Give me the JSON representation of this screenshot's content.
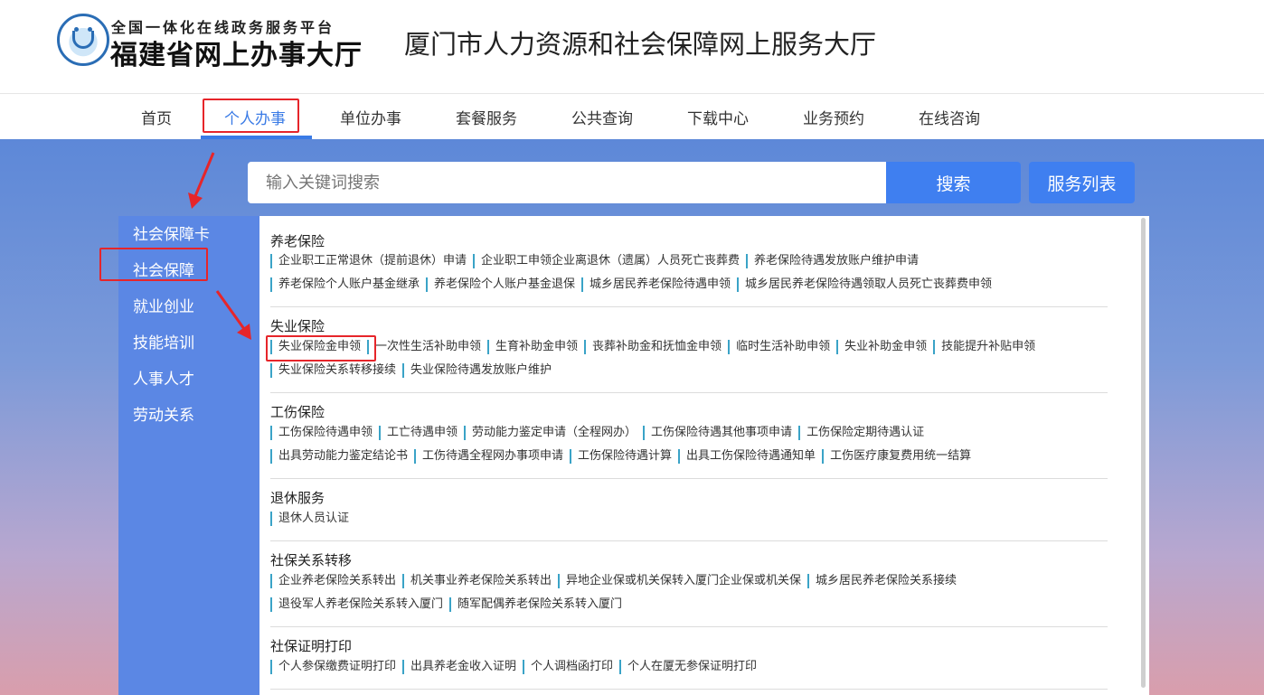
{
  "header": {
    "logo_sub": "全国一体化在线政务服务平台",
    "logo_main": "福建省网上办事大厅",
    "site_title": "厦门市人力资源和社会保障网上服务大厅"
  },
  "nav": {
    "items": [
      "首页",
      "个人办事",
      "单位办事",
      "套餐服务",
      "公共查询",
      "下载中心",
      "业务预约",
      "在线咨询"
    ],
    "active": "个人办事"
  },
  "search": {
    "placeholder": "输入关键词搜索",
    "search_label": "搜索",
    "list_label": "服务列表"
  },
  "sidebar": {
    "items": [
      "社会保障卡",
      "社会保障",
      "就业创业",
      "技能培训",
      "人事人才",
      "劳动关系"
    ],
    "selected": "社会保障"
  },
  "sections": [
    {
      "title": "养老保险",
      "rows": [
        [
          "企业职工正常退休（提前退休）申请",
          "企业职工申领企业离退休（遗属）人员死亡丧葬费",
          "养老保险待遇发放账户维护申请"
        ],
        [
          "养老保险个人账户基金继承",
          "养老保险个人账户基金退保",
          "城乡居民养老保险待遇申领",
          "城乡居民养老保险待遇领取人员死亡丧葬费申领"
        ]
      ]
    },
    {
      "title": "失业保险",
      "rows": [
        [
          "失业保险金申领",
          "一次性生活补助申领",
          "生育补助金申领",
          "丧葬补助金和抚恤金申领",
          "临时生活补助申领",
          "失业补助金申领",
          "技能提升补贴申领"
        ],
        [
          "失业保险关系转移接续",
          "失业保险待遇发放账户维护"
        ]
      ]
    },
    {
      "title": "工伤保险",
      "rows": [
        [
          "工伤保险待遇申领",
          "工亡待遇申领",
          "劳动能力鉴定申请（全程网办）",
          "工伤保险待遇其他事项申请",
          "工伤保险定期待遇认证"
        ],
        [
          "出具劳动能力鉴定结论书",
          "工伤待遇全程网办事项申请",
          "工伤保险待遇计算",
          "出具工伤保险待遇通知单",
          "工伤医疗康复费用统一结算"
        ]
      ]
    },
    {
      "title": "退休服务",
      "rows": [
        [
          "退休人员认证"
        ]
      ]
    },
    {
      "title": "社保关系转移",
      "rows": [
        [
          "企业养老保险关系转出",
          "机关事业养老保险关系转出",
          "异地企业保或机关保转入厦门企业保或机关保",
          "城乡居民养老保险关系接续"
        ],
        [
          "退役军人养老保险关系转入厦门",
          "随军配偶养老保险关系转入厦门"
        ]
      ]
    },
    {
      "title": "社保证明打印",
      "rows": [
        [
          "个人参保缴费证明打印",
          "出具养老金收入证明",
          "个人调档函打印",
          "个人在厦无参保证明打印"
        ]
      ]
    }
  ],
  "colors": {
    "accent": "#3f7ff0",
    "sidebar": "#5b87e4",
    "highlight_box": "#e6252a",
    "link_bar": "#3aa3c7"
  }
}
